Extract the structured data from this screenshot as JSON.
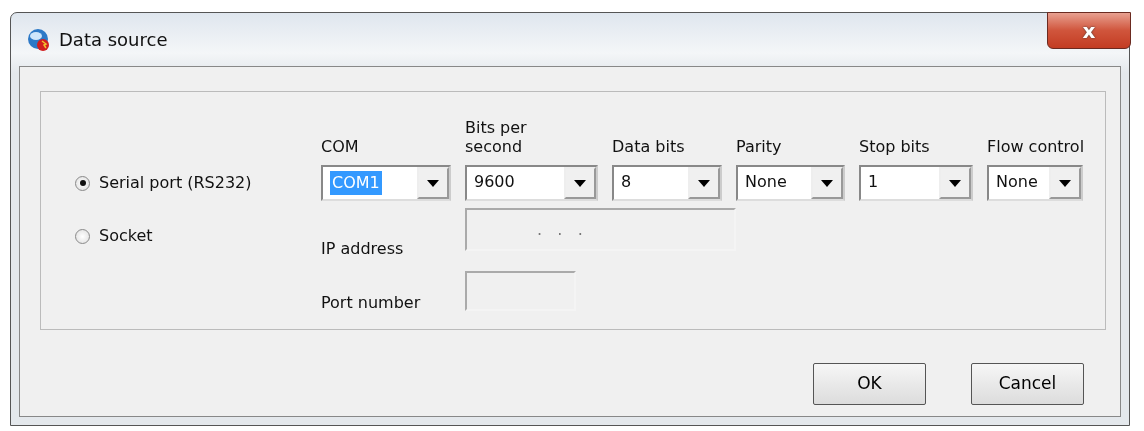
{
  "window": {
    "title": "Data source",
    "close_label": "x"
  },
  "modes": [
    {
      "label": "Serial port (RS232)",
      "selected": true
    },
    {
      "label": "Socket",
      "selected": false
    }
  ],
  "serial_settings": [
    {
      "label": "COM",
      "value": "COM1",
      "highlighted": true
    },
    {
      "label": "Bits per second",
      "value": "9600",
      "highlighted": false
    },
    {
      "label": "Data bits",
      "value": "8",
      "highlighted": false
    },
    {
      "label": "Parity",
      "value": "None",
      "highlighted": false
    },
    {
      "label": "Stop bits",
      "value": "1",
      "highlighted": false
    },
    {
      "label": "Flow control",
      "value": "None",
      "highlighted": false
    }
  ],
  "ip_address": {
    "label": "IP address",
    "value": ".   .   .",
    "disabled": true
  },
  "port_number": {
    "label": "Port number",
    "disabled": true
  },
  "buttons": [
    "OK",
    "Cancel"
  ]
}
